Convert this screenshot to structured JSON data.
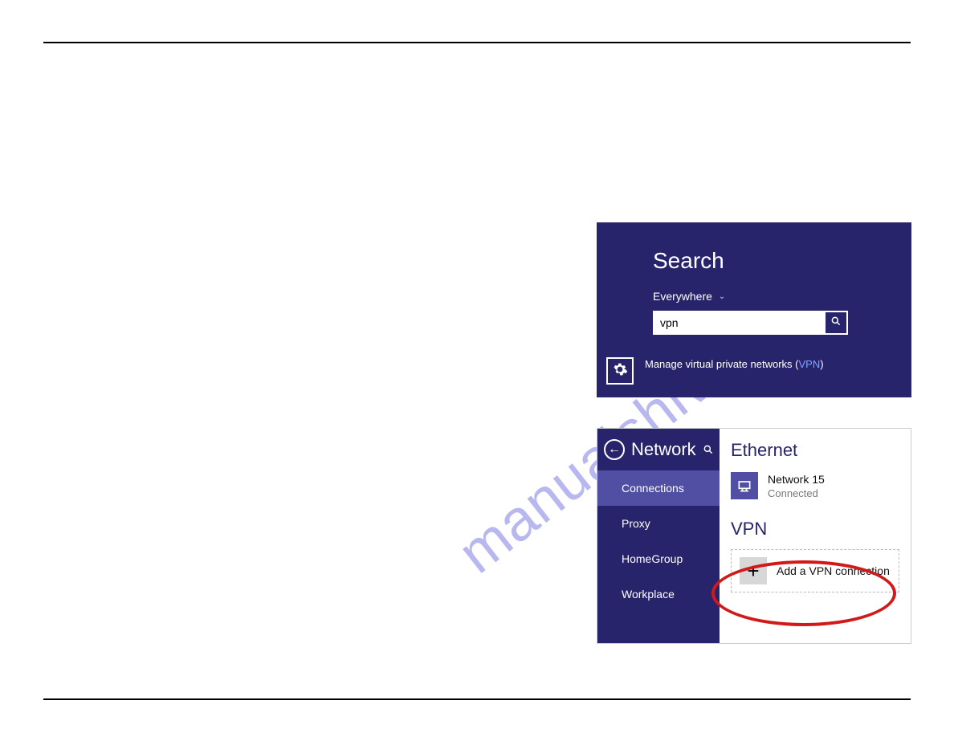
{
  "watermark": "manualshive.com",
  "search": {
    "title": "Search",
    "scope": "Everywhere",
    "value": "vpn",
    "result_prefix": "Manage virtual private networks (",
    "result_vpn": "VPN",
    "result_suffix": ")"
  },
  "network": {
    "header": "Network",
    "items": [
      "Connections",
      "Proxy",
      "HomeGroup",
      "Workplace"
    ],
    "ethernet_title": "Ethernet",
    "ethernet_name": "Network 15",
    "ethernet_status": "Connected",
    "vpn_title": "VPN",
    "add_vpn_label": "Add a VPN connection"
  }
}
